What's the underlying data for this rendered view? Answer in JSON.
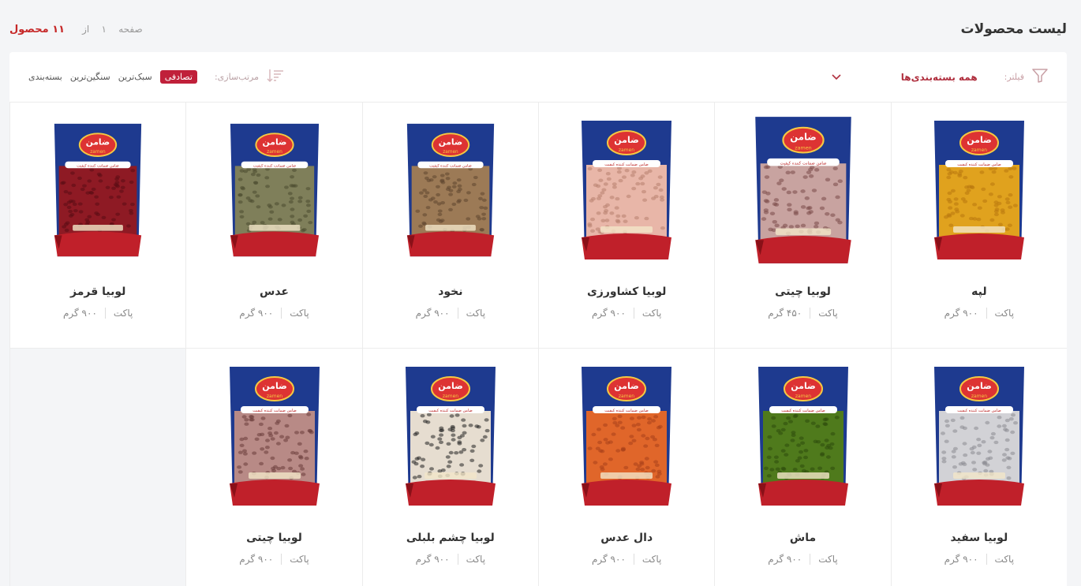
{
  "header": {
    "title": "لیست محصولات",
    "page_label": "صفحه",
    "page_number": "۱",
    "of_label": "از",
    "product_count": "۱۱ محصول"
  },
  "toolbar": {
    "filter_label": "فیلتر:",
    "filter_value": "همه بسته‌بندی‌ها",
    "sort_label": "مرتب‌سازی:",
    "sort_options": [
      "تصادفی",
      "سبک‌ترین",
      "سنگین‌ترین",
      "بسته‌بندی"
    ],
    "sort_active_index": 0
  },
  "colors": {
    "accent": "#c0203a",
    "pack_blue": "#1e3a8f",
    "pack_red": "#c0202a"
  },
  "products": [
    {
      "name": "لپه",
      "package": "پاکت",
      "weight": "۹۰۰ گرم",
      "fill": "#e0a21e",
      "dot": "#b8760f"
    },
    {
      "name": "لوبیا چیتی",
      "package": "پاکت",
      "weight": "۴۵۰ گرم",
      "fill": "#c8a3a0",
      "dot": "#7a4a48"
    },
    {
      "name": "لوبیا کشاورزی",
      "package": "پاکت",
      "weight": "۹۰۰ گرم",
      "fill": "#e8b6a8",
      "dot": "#b6806e"
    },
    {
      "name": "نخود",
      "package": "پاکت",
      "weight": "۹۰۰ گرم",
      "fill": "#9c7a56",
      "dot": "#5e4630"
    },
    {
      "name": "عدس",
      "package": "پاکت",
      "weight": "۹۰۰ گرم",
      "fill": "#7f7f5a",
      "dot": "#4a4a30"
    },
    {
      "name": "لوبیا قرمز",
      "package": "پاکت",
      "weight": "۹۰۰ گرم",
      "fill": "#8e1a24",
      "dot": "#5a0c14"
    },
    {
      "name": "لوبیا سفید",
      "package": "پاکت",
      "weight": "۹۰۰ گرم",
      "fill": "#d2d2d6",
      "dot": "#8a8a92"
    },
    {
      "name": "ماش",
      "package": "پاکت",
      "weight": "۹۰۰ گرم",
      "fill": "#4f7a1c",
      "dot": "#2d4a0c"
    },
    {
      "name": "دال عدس",
      "package": "پاکت",
      "weight": "۹۰۰ گرم",
      "fill": "#e0662a",
      "dot": "#a8401a"
    },
    {
      "name": "لوبیا چشم بلبلی",
      "package": "پاکت",
      "weight": "۹۰۰ گرم",
      "fill": "#e6ddd0",
      "dot": "#222222"
    },
    {
      "name": "لوبیا چیتی",
      "package": "پاکت",
      "weight": "۹۰۰ گرم",
      "fill": "#b88a86",
      "dot": "#6a3c3a"
    }
  ],
  "pack": {
    "brand": "ضامن",
    "brand_latin": "zamen",
    "ribbon": "ضامن ضمانت کننده کیفیت"
  }
}
